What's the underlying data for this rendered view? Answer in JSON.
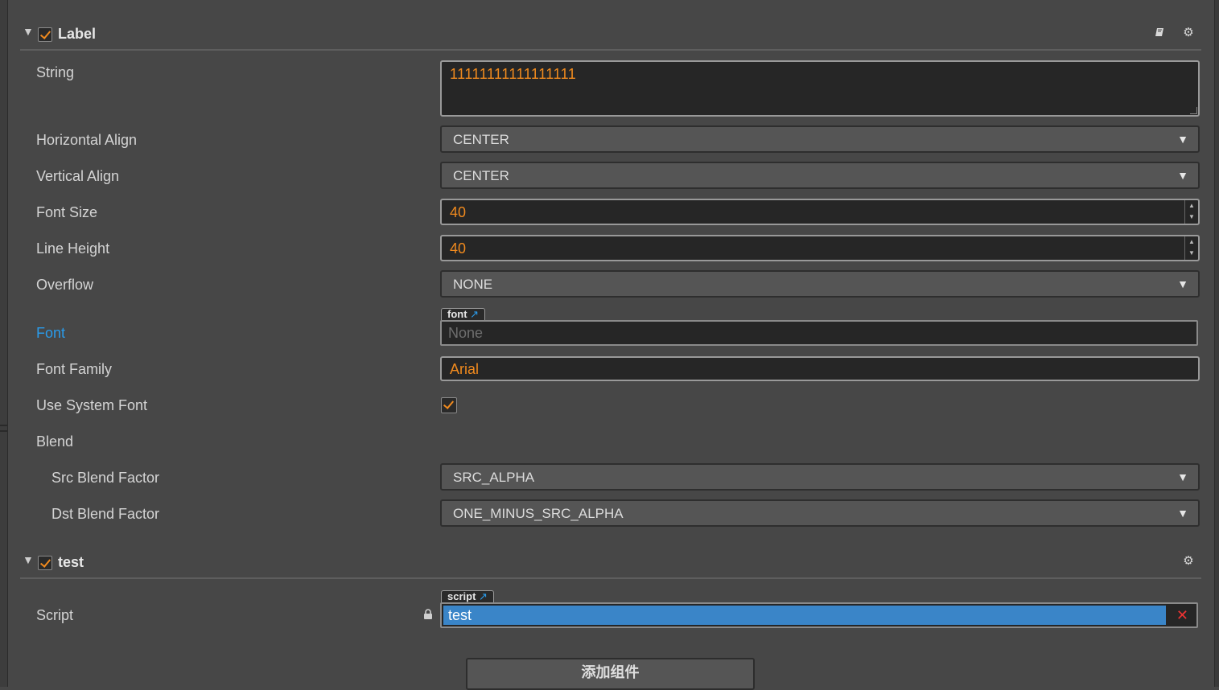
{
  "components": [
    {
      "title": "Label",
      "enabled": true,
      "properties": {
        "string": {
          "label": "String",
          "value": "11111111111111111"
        },
        "horizontal_align": {
          "label": "Horizontal Align",
          "value": "CENTER"
        },
        "vertical_align": {
          "label": "Vertical Align",
          "value": "CENTER"
        },
        "font_size": {
          "label": "Font Size",
          "value": "40"
        },
        "line_height": {
          "label": "Line Height",
          "value": "40"
        },
        "overflow": {
          "label": "Overflow",
          "value": "NONE"
        },
        "font": {
          "label": "Font",
          "asset_type": "font",
          "value": "None"
        },
        "font_family": {
          "label": "Font Family",
          "value": "Arial"
        },
        "use_system_font": {
          "label": "Use System Font",
          "checked": true
        },
        "blend": {
          "label": "Blend"
        },
        "src_blend_factor": {
          "label": "Src Blend Factor",
          "value": "SRC_ALPHA"
        },
        "dst_blend_factor": {
          "label": "Dst Blend Factor",
          "value": "ONE_MINUS_SRC_ALPHA"
        }
      },
      "icons": [
        "book-icon",
        "gear-icon"
      ]
    },
    {
      "title": "test",
      "enabled": true,
      "properties": {
        "script": {
          "label": "Script",
          "asset_type": "script",
          "value": "test"
        }
      },
      "icons": [
        "gear-icon"
      ]
    }
  ],
  "add_component_label": "添加组件",
  "colors": {
    "accent": "#f08a1e",
    "link": "#2a9bea",
    "selection": "#3a85c8",
    "panel": "#474747"
  }
}
